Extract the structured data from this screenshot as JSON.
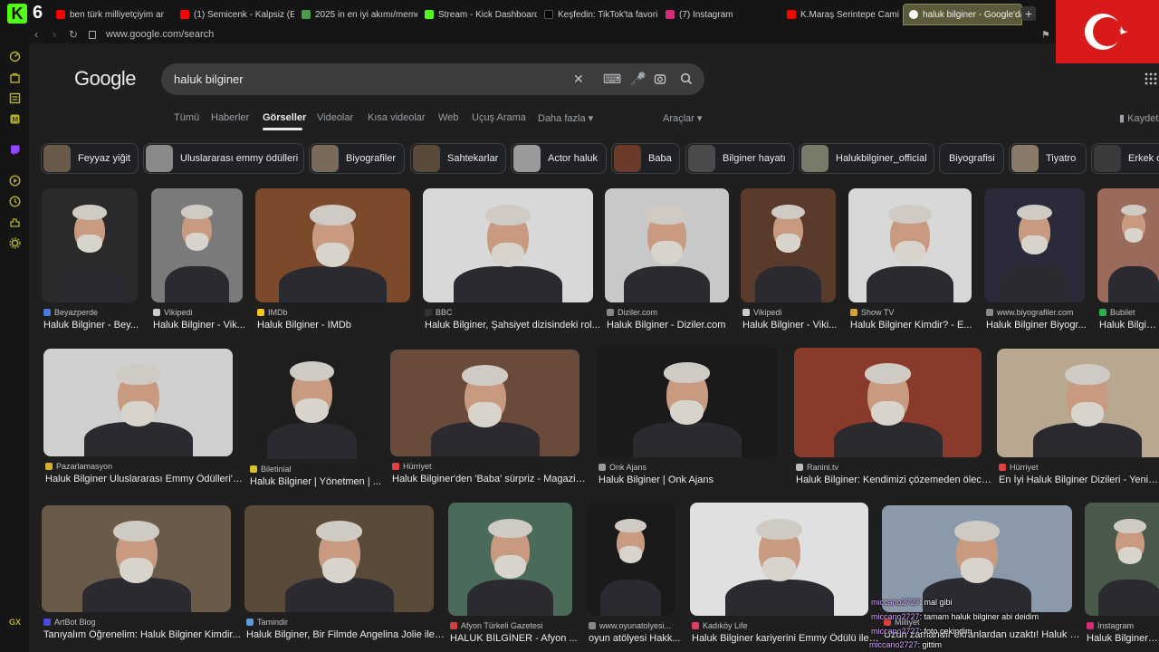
{
  "browser": {
    "kick_count": "6",
    "url": "www.google.com/search",
    "tabs": [
      {
        "label": "ben türk milliyetçiyim ar",
        "color": "#ff0000"
      },
      {
        "label": "(1) Semicenk - Kalpsiz (En",
        "color": "#ff0000"
      },
      {
        "label": "2025 in en iyi akımı/meme",
        "color": "#4a9a4a"
      },
      {
        "label": "Stream - Kick Dashboard",
        "color": "#53fc18"
      },
      {
        "label": "Keşfedin: TikTok'ta favori",
        "color": "#111111"
      },
      {
        "label": "(7) Instagram",
        "color": "#d62976"
      },
      {
        "label": "K.Maraş Serintepe Cami Y",
        "color": "#ff0000"
      },
      {
        "label": "haluk bilginer - Google'da",
        "color": "#4285f4"
      }
    ],
    "new_tab": "+"
  },
  "google": {
    "logo": "Google",
    "query": "haluk bilginer",
    "nav": [
      "Tümü",
      "Haberler",
      "Görseller",
      "Videolar",
      "Kısa videolar",
      "Web",
      "Uçuş Arama",
      "Daha fazla ▾"
    ],
    "tools": "Araçlar ▾",
    "save": "Kaydet"
  },
  "chips": [
    {
      "label": "Feyyaz yiğit",
      "thumb": "#6a5a4a"
    },
    {
      "label": "Uluslararası emmy ödülleri",
      "thumb": "#8a8a8a"
    },
    {
      "label": "Biyografiler",
      "thumb": "#7a6a5a"
    },
    {
      "label": "Sahtekarlar",
      "thumb": "#5a4a3a"
    },
    {
      "label": "Actor haluk",
      "thumb": "#9a9a9a"
    },
    {
      "label": "Baba",
      "thumb": "#6a3a2a"
    },
    {
      "label": "Bilginer hayatı",
      "thumb": "#4a4a4a"
    },
    {
      "label": "Halukbilginer_official",
      "thumb": "#7a7a6a"
    },
    {
      "label": "Biyografisi",
      "thumb": null
    },
    {
      "label": "Tiyatro",
      "thumb": "#8a7a6a"
    },
    {
      "label": "Erkek o",
      "thumb": "#3a3a3a"
    }
  ],
  "results": [
    {
      "source": "Beyazperde",
      "title": "Haluk Bilginer - Bey...",
      "bg": "#2a2a2a",
      "favcolor": "#4a7adf"
    },
    {
      "source": "Vikipedi",
      "title": "Haluk Bilginer - Vik...",
      "bg": "#7a7a7a",
      "favcolor": "#cccccc"
    },
    {
      "source": "IMDb",
      "title": "Haluk Bilginer - IMDb",
      "bg": "#7a4a2a",
      "favcolor": "#f5c518"
    },
    {
      "source": "BBC",
      "title": "Haluk Bilginer, Şahsiyet dizisindeki rol...",
      "bg": "#d8d8d8",
      "favcolor": "#333333"
    },
    {
      "source": "Diziler.com",
      "title": "Haluk Bilginer - Diziler.com",
      "bg": "#c8c8c8",
      "favcolor": "#888888"
    },
    {
      "source": "Vikipedi",
      "title": "Haluk Bilginer - Viki...",
      "bg": "#5a3a2a",
      "favcolor": "#cccccc"
    },
    {
      "source": "Show TV",
      "title": "Haluk Bilginer Kimdir? - E...",
      "bg": "#d8d8d8",
      "favcolor": "#d8a030"
    },
    {
      "source": "www.biyografiler.com",
      "title": "Haluk Bilginer Biyogr...",
      "bg": "#2a2a3a",
      "favcolor": "#888888"
    },
    {
      "source": "Bubilet",
      "title": "Haluk Bilginer",
      "bg": "#9a6a5a",
      "favcolor": "#2ab04a"
    },
    {
      "source": "Pazarlamasyon",
      "title": "Haluk Bilginer Uluslararası Emmy Ödülleri'n...",
      "bg": "#d0d0d0",
      "favcolor": "#d8b030"
    },
    {
      "source": "Biletinial",
      "title": "Haluk Bilginer | Yönetmen | ...",
      "bg": "#1e1e1e",
      "favcolor": "#d8c030"
    },
    {
      "source": "Hürriyet",
      "title": "Haluk Bilginer'den 'Baba' sürpriz - Magazin ...",
      "bg": "#6a4a3a",
      "favcolor": "#e04040"
    },
    {
      "source": "Onk Ajans",
      "title": "Haluk Bilginer | Onk Ajans",
      "bg": "#1a1a1a",
      "favcolor": "#999999"
    },
    {
      "source": "Ranini.tv",
      "title": "Haluk Bilginer: Kendimizi çözemeden ölece...",
      "bg": "#8a3a2a",
      "favcolor": "#bbbbbb"
    },
    {
      "source": "Hürriyet",
      "title": "En İyi Haluk Bilginer Dizileri - Yeni Ve Es...",
      "bg": "#b8a890",
      "favcolor": "#e04040"
    },
    {
      "source": "ArtBot Blog",
      "title": "Tanıyalım Öğrenelim: Haluk Bilginer Kimdir...",
      "bg": "#6a5a4a",
      "favcolor": "#4a4adf"
    },
    {
      "source": "Tamindir",
      "title": "Haluk Bilginer, Bir Filmde Angelina Jolie ile ...",
      "bg": "#5a4a3a",
      "favcolor": "#5a9adf"
    },
    {
      "source": "Afyon Türkeli Gazetesi",
      "title": "HALUK BİLGİNER - Afyon ...",
      "bg": "#4a6a5a",
      "favcolor": "#d04040"
    },
    {
      "source": "www.oyunatolyesi...",
      "title": "oyun atölyesi Hakk...",
      "bg": "#1a1a1a",
      "favcolor": "#888888"
    },
    {
      "source": "Kadıköy Life",
      "title": "Haluk Bilginer kariyerini Emmy Ödülü ile ...",
      "bg": "#e0e0e0",
      "favcolor": "#e04060"
    },
    {
      "source": "Milliyet",
      "title": "Uzun zamandır ekranlardan uzaktı! Haluk B...",
      "bg": "#8a9aaa",
      "favcolor": "#e04040"
    },
    {
      "source": "Instagram",
      "title": "Haluk Bilginer (#ha...",
      "bg": "#4a5a4a",
      "favcolor": "#d62976"
    }
  ],
  "chat": [
    {
      "user": "miccano2727",
      "msg": ": mal gibi"
    },
    {
      "user": "miccano2727",
      "msg": ": tamam haluk bilginer abi deidim"
    },
    {
      "user": "miccano2727",
      "msg": ": foto çekindim"
    },
    {
      "user": "miccano2727",
      "msg": ": gittim"
    }
  ],
  "sidebar": {
    "gx_label": "GX"
  },
  "colors": {
    "accent": "#53fc18",
    "page_bg": "#1f1f1f",
    "flag_red": "#d81a1a"
  }
}
